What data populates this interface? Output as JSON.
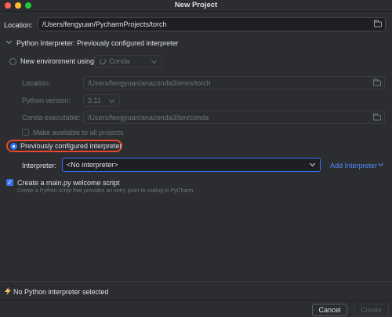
{
  "window": {
    "title": "New Project"
  },
  "location": {
    "label": "Location:",
    "value": "/Users/fengyuan/PycharmProjects/torch"
  },
  "interpreter_section": {
    "title": "Python Interpreter: Previously configured interpreter"
  },
  "new_env": {
    "radio_label": "New environment using",
    "tool_value": "Conda",
    "location_label": "Location:",
    "location_value": "/Users/fengyuan/anaconda3/envs/torch",
    "python_version_label": "Python version:",
    "python_version_value": "3.11",
    "conda_exe_label": "Conda executable:",
    "conda_exe_value": "/Users/fengyuan/anaconda3/bin/conda",
    "make_available_label": "Make available to all projects"
  },
  "previous": {
    "radio_label": "Previously configured interpreter",
    "interpreter_label": "Interpreter:",
    "interpreter_value": "<No interpreter>",
    "add_interpreter_label": "Add Interpreter"
  },
  "welcome": {
    "checkbox_label": "Create a main.py welcome script",
    "description": "Create a Python script that provides an entry point to coding in PyCharm."
  },
  "status": {
    "message": "No Python interpreter selected",
    "icon": "lightning-icon"
  },
  "buttons": {
    "cancel": "Cancel",
    "create": "Create"
  },
  "colors": {
    "accent": "#3574f0",
    "highlight": "#e5482d",
    "warning": "#f2c55c"
  }
}
